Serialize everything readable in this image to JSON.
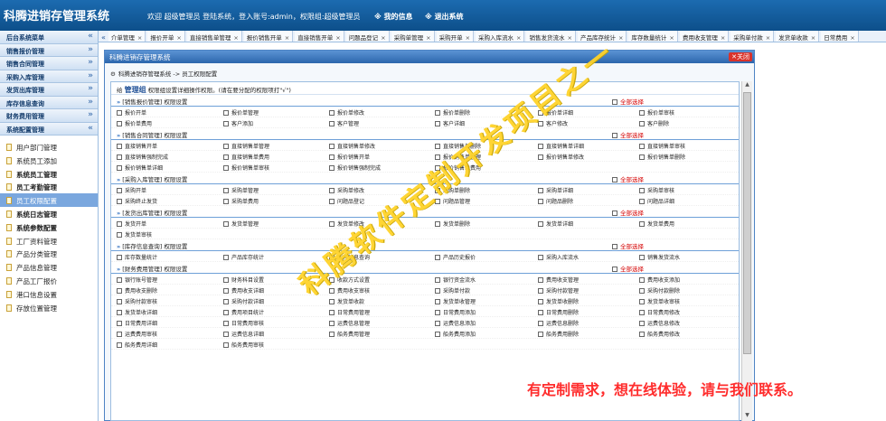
{
  "header": {
    "app_title": "科腾进销存管理系统",
    "welcome_text": "欢迎  超级管理员  登陆系统，登入账号:admin，权限组:超级管理员",
    "my_info": "※ 我的信息",
    "logout": "※ 退出系统"
  },
  "sidebar": {
    "accordion": [
      {
        "label": "后台系统菜单",
        "chev": "«"
      },
      {
        "label": "销售报价管理",
        "chev": "»"
      },
      {
        "label": "销售合同管理",
        "chev": "»"
      },
      {
        "label": "采购入库管理",
        "chev": "»"
      },
      {
        "label": "发货出库管理",
        "chev": "»"
      },
      {
        "label": "库存信息查询",
        "chev": "»"
      },
      {
        "label": "财务费用管理",
        "chev": "»"
      },
      {
        "label": "系统配置管理",
        "chev": "«"
      }
    ],
    "items": [
      {
        "label": "用户部门管理",
        "bold": false
      },
      {
        "label": "系统员工添加",
        "bold": false
      },
      {
        "label": "系统员工管理",
        "bold": true
      },
      {
        "label": "员工考勤管理",
        "bold": true
      },
      {
        "label": "员工权限配置",
        "bold": false
      },
      {
        "label": "系统日志管理",
        "bold": true
      },
      {
        "label": "系统参数配置",
        "bold": true
      },
      {
        "label": "工厂资料管理",
        "bold": false
      },
      {
        "label": "产品分类管理",
        "bold": false
      },
      {
        "label": "产品信息管理",
        "bold": false
      },
      {
        "label": "产品工厂报价",
        "bold": false
      },
      {
        "label": "港口信息设置",
        "bold": false
      },
      {
        "label": "存放位置管理",
        "bold": false
      }
    ],
    "selected_index": 4
  },
  "tabs": {
    "nav_prev": "«",
    "items": [
      "介单管理",
      "报价开单",
      "直接销售单管理",
      "报价销售开单",
      "直接销售开单",
      "问题品登记",
      "采购单管理",
      "采购开单",
      "采购入库流水",
      "销售发货流水",
      "产品库存统计",
      "库存数量统计",
      "费用收支管理",
      "采购单付款",
      "发货单收款",
      "日常费用"
    ]
  },
  "dialog": {
    "title": "科腾进销存管理系统",
    "close_label": "关闭",
    "breadcrumb": "科腾进销存管理系统 -> 员工权限配置",
    "group_prefix": "给",
    "group_name": "管理组",
    "group_hint": "权限组设置详细操作权限。(请在要分配的权限项打\"√\")",
    "select_all": "全部选择",
    "sections": [
      {
        "title": "[销售报价管理] 权限设置",
        "rows": [
          [
            "报价开单",
            "报价单管理",
            "报价单修改",
            "报价单删除",
            "报价单详细",
            "报价单审核"
          ],
          [
            "报价单费用",
            "客户添加",
            "客户管理",
            "客户详细",
            "客户修改",
            "客户删除"
          ]
        ]
      },
      {
        "title": "[销售合同管理] 权限设置",
        "rows": [
          [
            "直接销售开单",
            "直接销售单管理",
            "直接销售单修改",
            "直接销售单删除",
            "直接销售单详细",
            "直接销售单审核"
          ],
          [
            "直接销售强制完成",
            "直接销售单费用",
            "报价销售开单",
            "报价销售单管理",
            "报价销售单修改",
            "报价销售单删除"
          ],
          [
            "报价销售单详细",
            "报价销售单审核",
            "报价销售强制完成",
            "报价销售单费用"
          ]
        ]
      },
      {
        "title": "[采购入库管理] 权限设置",
        "rows": [
          [
            "采购开单",
            "采购单管理",
            "采购单修改",
            "采购单删除",
            "采购单详细",
            "采购单审核"
          ],
          [
            "采购终止发货",
            "采购单费用",
            "问题品登记",
            "问题品管理",
            "问题品删除",
            "问题品详细"
          ]
        ]
      },
      {
        "title": "[发货出库管理] 权限设置",
        "rows": [
          [
            "发货开单",
            "发货单管理",
            "发货单修改",
            "发货单删除",
            "发货单详细",
            "发货单费用"
          ],
          [
            "发货单审核"
          ]
        ]
      },
      {
        "title": "[库存信息查询] 权限设置",
        "rows": [
          [
            "库存数量统计",
            "产品库存统计",
            "库存信息查询",
            "产品历史报价",
            "采购入库流水",
            "销售发货流水"
          ]
        ]
      },
      {
        "title": "[财务费用管理] 权限设置",
        "rows": [
          [
            "银行账号管理",
            "财务科目设置",
            "收款方式设置",
            "银行资金流水",
            "费用收支管理",
            "费用收支添加"
          ],
          [
            "费用收支删除",
            "费用收支详细",
            "费用收支审核",
            "采购单付款",
            "采购付款管理",
            "采购付款删除"
          ],
          [
            "采购付款审核",
            "采购付款详细",
            "发货单收款",
            "发货单收管理",
            "发货单收删除",
            "发货单收审核"
          ],
          [
            "发货单收详细",
            "费用项目统计",
            "日常费用管理",
            "日常费用添加",
            "日常费用删除",
            "日常费用修改"
          ],
          [
            "日常费用详细",
            "日常费用审核",
            "运费信息管理",
            "运费信息添加",
            "运费信息删除",
            "运费信息修改"
          ],
          [
            "运费费用审核",
            "运费信息详细",
            "船务费用管理",
            "船务费用添加",
            "船务费用删除",
            "船务费用修改"
          ],
          [
            "船务费用详细",
            "船务费用审核"
          ]
        ]
      }
    ]
  },
  "watermark": {
    "diagonal": "科腾软件定制开发项目之一",
    "bottom": "有定制需求，想在线体验，请与我们联系。"
  },
  "colors": {
    "header_bg": "#0d4f8a",
    "select_all_red": "#d40000",
    "watermark_yellow": "#ffd32a",
    "watermark_red": "#ff2d2d",
    "selected_item": "#7aa7de"
  }
}
